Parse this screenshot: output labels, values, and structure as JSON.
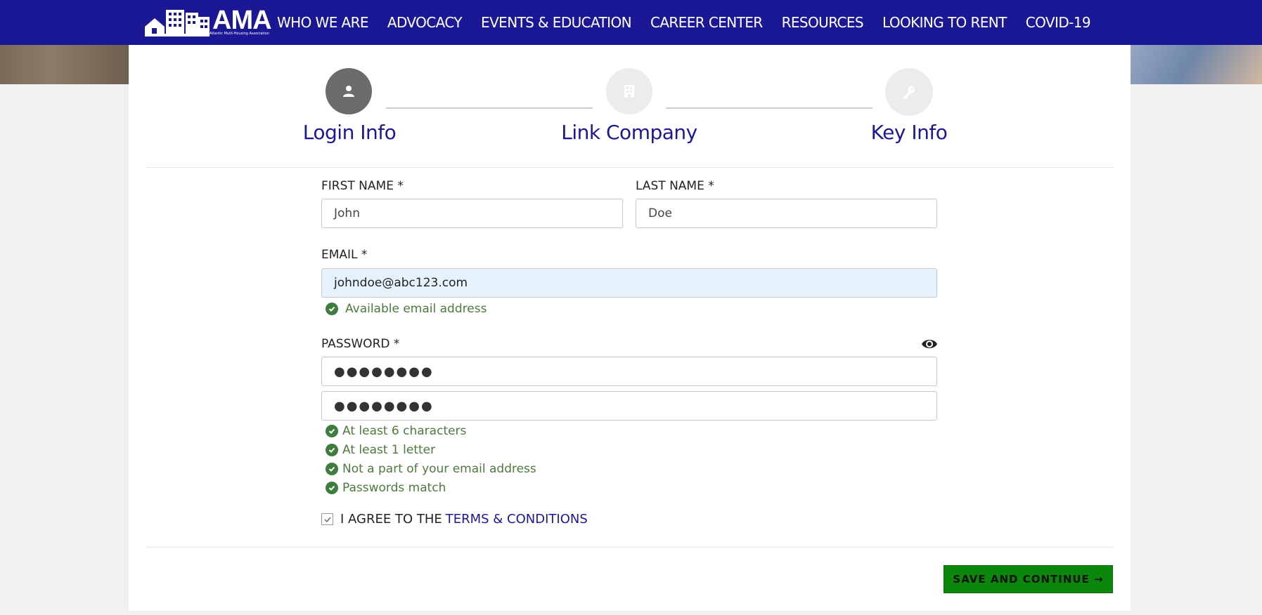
{
  "header": {
    "logo_text": "AMA",
    "logo_tagline": "Atlantic Multi-Housing Association",
    "nav": [
      "WHO WE ARE",
      "ADVOCACY",
      "EVENTS & EDUCATION",
      "CAREER CENTER",
      "RESOURCES",
      "LOOKING TO RENT",
      "COVID-19"
    ]
  },
  "stepper": {
    "steps": [
      {
        "label": "Login Info",
        "icon": "user-icon",
        "state": "active"
      },
      {
        "label": "Link Company",
        "icon": "building-icon",
        "state": "inactive"
      },
      {
        "label": "Key Info",
        "icon": "key-icon",
        "state": "inactive"
      }
    ]
  },
  "form": {
    "first_name": {
      "label": "FIRST NAME *",
      "value": "John"
    },
    "last_name": {
      "label": "LAST NAME *",
      "value": "Doe"
    },
    "email": {
      "label": "EMAIL *",
      "value": "johndoe@abc123.com",
      "status": "Available email address"
    },
    "password": {
      "label": "PASSWORD *",
      "value": "●●●●●●●●",
      "confirm_value": "●●●●●●●●"
    },
    "password_rules": [
      "At least 6 characters",
      "At least 1 letter",
      "Not a part of your email address",
      "Passwords match"
    ],
    "agree_prefix": "I AGREE TO THE",
    "terms_link": "TERMS & CONDITIONS",
    "submit_label": "SAVE AND CONTINUE →"
  },
  "colors": {
    "brand": "#1b1896",
    "success": "#4c7a3c",
    "button": "#0b870b"
  }
}
